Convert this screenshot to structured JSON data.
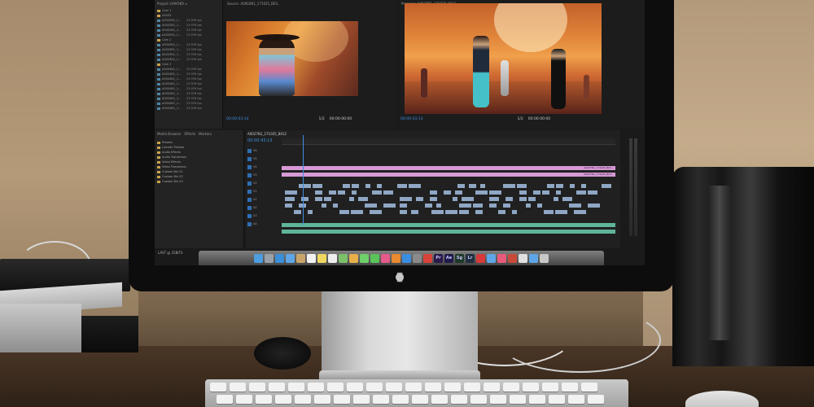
{
  "project_panel": {
    "title": "Project: HAVOK9 ≡",
    "rows": [
      {
        "type": "folder",
        "name": "Cam 1",
        "frame": ""
      },
      {
        "type": "folder",
        "name": "A0003",
        "frame": ""
      },
      {
        "type": "clip",
        "name": "A0002N1_1...",
        "frame": "23.976 fps"
      },
      {
        "type": "clip",
        "name": "A0002N1_1...",
        "frame": "23.976 fps"
      },
      {
        "type": "clip",
        "name": "A0002N1_1...",
        "frame": "23.976 fps"
      },
      {
        "type": "clip",
        "name": "A0002N1_1...",
        "frame": "23.976 fps"
      },
      {
        "type": "folder",
        "name": "Cam 2",
        "frame": ""
      },
      {
        "type": "clip",
        "name": "A0003N1_1...",
        "frame": "23.976 fps"
      },
      {
        "type": "clip",
        "name": "A0003N1_1...",
        "frame": "23.976 fps"
      },
      {
        "type": "clip",
        "name": "A0003N1_1...",
        "frame": "23.976 fps"
      },
      {
        "type": "clip",
        "name": "A0003N1_1...",
        "frame": "23.976 fps"
      },
      {
        "type": "folder",
        "name": "Cam 3",
        "frame": ""
      },
      {
        "type": "clip",
        "name": "A0004N1_1...",
        "frame": "23.976 fps"
      },
      {
        "type": "clip",
        "name": "A0004N1_1...",
        "frame": "23.976 fps"
      },
      {
        "type": "clip",
        "name": "A0004N1_1...",
        "frame": "23.976 fps"
      },
      {
        "type": "clip",
        "name": "A0004N1_1...",
        "frame": "23.976 fps"
      },
      {
        "type": "clip",
        "name": "A0004N1_1...",
        "frame": "23.976 fps"
      },
      {
        "type": "clip",
        "name": "A0004N1_1...",
        "frame": "23.976 fps"
      },
      {
        "type": "clip",
        "name": "A0004N1_1...",
        "frame": "23.976 fps"
      },
      {
        "type": "clip",
        "name": "A0004N1_1...",
        "frame": "23.976 fps"
      },
      {
        "type": "clip",
        "name": "A0004N1_1...",
        "frame": "23.976 fps"
      }
    ]
  },
  "effects_panel": {
    "tabs": [
      "Media Browser",
      "Effects",
      "Markers"
    ],
    "items": [
      "Presets",
      "Lumetri Presets",
      "Audio Effects",
      "Audio Transitions",
      "Video Effects",
      "Video Transitions",
      "Custom Bin 01",
      "Custom Bin 02",
      "Custom Bin 03"
    ]
  },
  "source_monitor": {
    "title": "Source: A0002N1_171025_B03...",
    "timecode_left": "00:00:03:14",
    "fit": "1/2",
    "timecode_right": "00:00:00:00"
  },
  "program_monitor": {
    "title": "Program: A0027N1_171025_B012",
    "timecode_left": "00:00:43:13",
    "fit": "1/2",
    "timecode_right": "00:00:00:00"
  },
  "timeline": {
    "sequence_tab": "A0027N1_171025_B012",
    "timecode": "00:00:43:13",
    "pink_clip_labels": [
      "A0027N1_171025_B01...",
      "A0027N1_171025_B01..."
    ],
    "tracks": [
      "V6",
      "V5",
      "V4",
      "V3",
      "V2",
      "V1",
      "A1",
      "A2",
      "A3",
      "A4"
    ],
    "bottom_status": "LAST @ 25BITS"
  },
  "dock": {
    "icons": [
      {
        "name": "finder-icon",
        "glyph": "",
        "color": "#4d9de0"
      },
      {
        "name": "launchpad-icon",
        "glyph": "",
        "color": "#9aa0a8"
      },
      {
        "name": "safari-icon",
        "glyph": "",
        "color": "#3a8fd8"
      },
      {
        "name": "mail-icon",
        "glyph": "",
        "color": "#5fa6e6"
      },
      {
        "name": "contacts-icon",
        "glyph": "",
        "color": "#c9a46a"
      },
      {
        "name": "calendar-icon",
        "glyph": "",
        "color": "#f2f2f2"
      },
      {
        "name": "notes-icon",
        "glyph": "",
        "color": "#f0d860"
      },
      {
        "name": "reminders-icon",
        "glyph": "",
        "color": "#eeeeee"
      },
      {
        "name": "maps-icon",
        "glyph": "",
        "color": "#7cc06a"
      },
      {
        "name": "photos-icon",
        "glyph": "",
        "color": "#e8b04a"
      },
      {
        "name": "messages-icon",
        "glyph": "",
        "color": "#6fcf6a"
      },
      {
        "name": "facetime-icon",
        "glyph": "",
        "color": "#5bc35a"
      },
      {
        "name": "itunes-icon",
        "glyph": "",
        "color": "#e45a8a"
      },
      {
        "name": "ibooks-icon",
        "glyph": "",
        "color": "#e88a2f"
      },
      {
        "name": "appstore-icon",
        "glyph": "",
        "color": "#3b8de0"
      },
      {
        "name": "preferences-icon",
        "glyph": "",
        "color": "#8a8a8a"
      },
      {
        "name": "chrome-icon",
        "glyph": "",
        "color": "#d8433a"
      },
      {
        "name": "premiere-icon",
        "glyph": "Pr",
        "color": "#2a1a4a"
      },
      {
        "name": "aftereffects-icon",
        "glyph": "Ae",
        "color": "#1f1a4a"
      },
      {
        "name": "speedgrade-icon",
        "glyph": "Sg",
        "color": "#1f3a2a"
      },
      {
        "name": "lightroom-icon",
        "glyph": "Lr",
        "color": "#1f2f3f"
      },
      {
        "name": "creativecloud-icon",
        "glyph": "",
        "color": "#d73a3a"
      },
      {
        "name": "folder-icon",
        "glyph": "",
        "color": "#5fa6e6"
      },
      {
        "name": "music-icon",
        "glyph": "",
        "color": "#e85a7a"
      },
      {
        "name": "photobooth-icon",
        "glyph": "",
        "color": "#c84a3a"
      },
      {
        "name": "screenflow-icon",
        "glyph": "",
        "color": "#e0e0e0"
      },
      {
        "name": "downloads-icon",
        "glyph": "",
        "color": "#5fa6e6"
      },
      {
        "name": "trash-icon",
        "glyph": "",
        "color": "#c8c8c8"
      }
    ]
  }
}
